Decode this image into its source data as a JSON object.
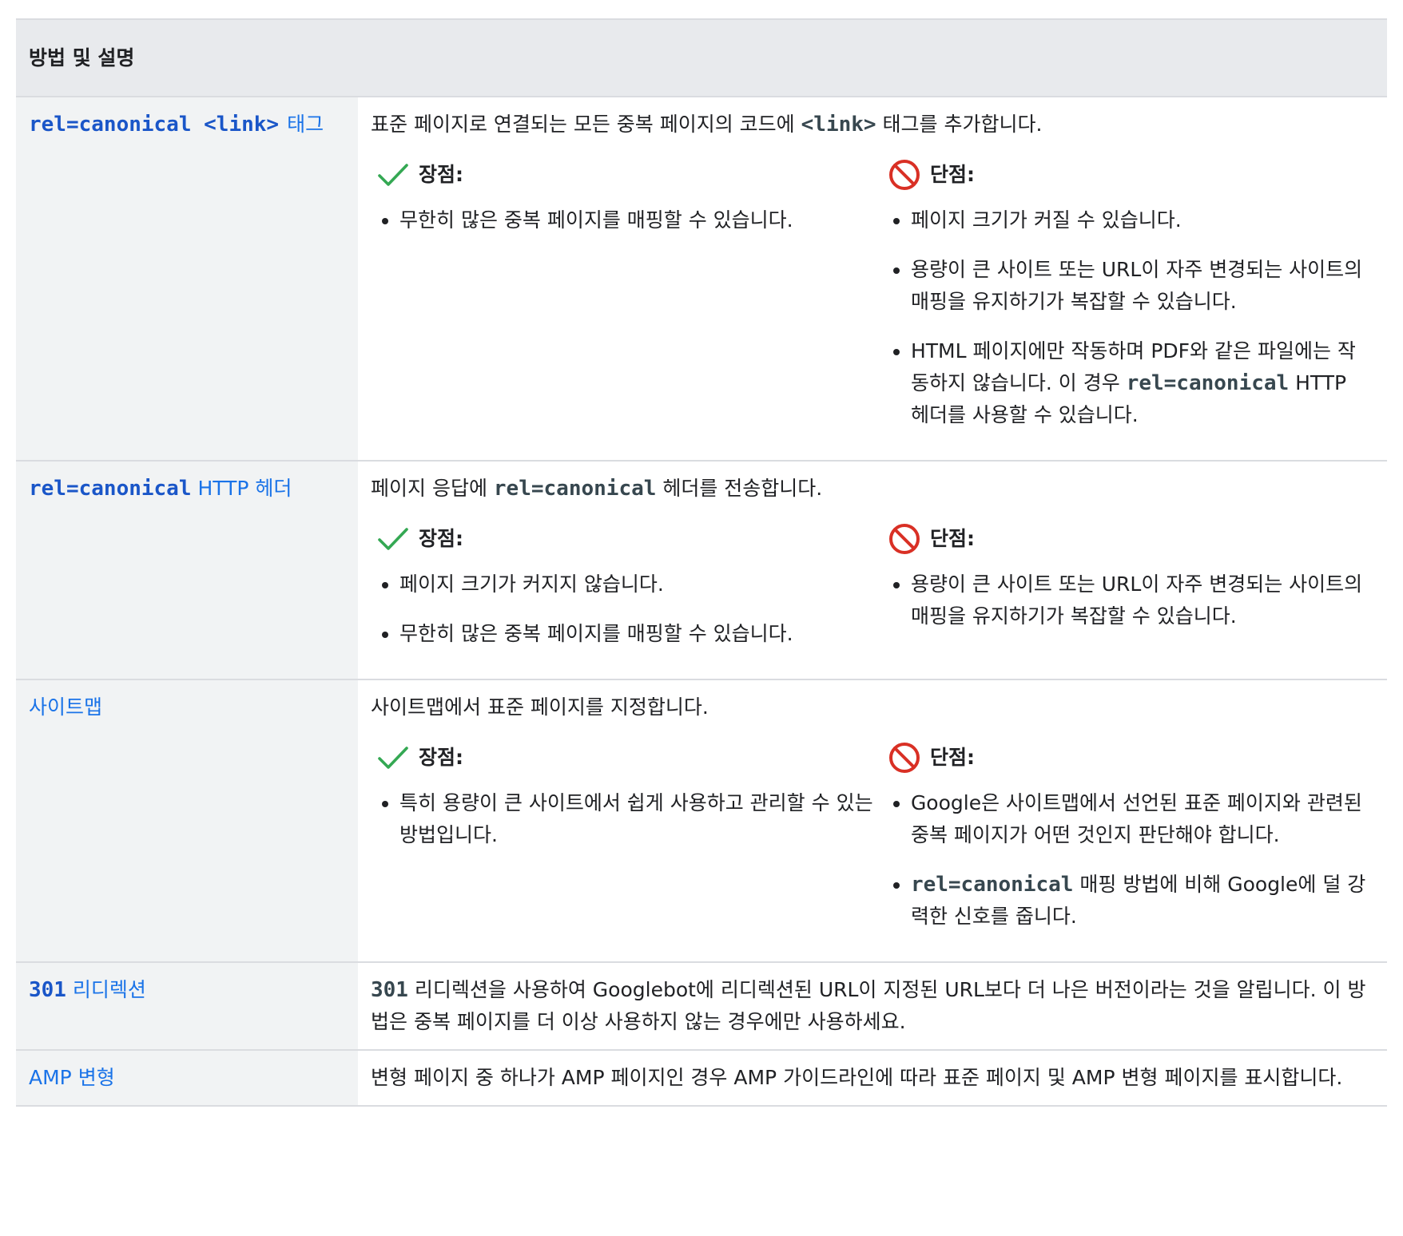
{
  "table": {
    "header": "방법 및 설명",
    "pros_label": "장점:",
    "cons_label": "단점:",
    "rows": [
      {
        "method_code": "rel=canonical <link>",
        "method_text": "태그",
        "summary": [
          {
            "t": "표준 페이지로 연결되는 모든 중복 페이지의 코드에 "
          },
          {
            "c": "<link>"
          },
          {
            "t": " 태그를 추가합니다."
          }
        ],
        "pros": [
          [
            {
              "t": "무한히 많은 중복 페이지를 매핑할 수 있습니다."
            }
          ]
        ],
        "cons": [
          [
            {
              "t": "페이지 크기가 커질 수 있습니다."
            }
          ],
          [
            {
              "t": "용량이 큰 사이트 또는 URL이 자주 변경되는 사이트의 매핑을 유지하기가 복잡할 수 있습니다."
            }
          ],
          [
            {
              "t": "HTML 페이지에만 작동하며 PDF와 같은 파일에는 작동하지 않습니다. 이 경우 "
            },
            {
              "c": "rel=canonical"
            },
            {
              "t": " HTTP 헤더를 사용할 수 있습니다."
            }
          ]
        ]
      },
      {
        "method_code": "rel=canonical",
        "method_text": " HTTP 헤더",
        "summary": [
          {
            "t": "페이지 응답에 "
          },
          {
            "c": "rel=canonical"
          },
          {
            "t": " 헤더를 전송합니다."
          }
        ],
        "pros": [
          [
            {
              "t": "페이지 크기가 커지지 않습니다."
            }
          ],
          [
            {
              "t": "무한히 많은 중복 페이지를 매핑할 수 있습니다."
            }
          ]
        ],
        "cons": [
          [
            {
              "t": "용량이 큰 사이트 또는 URL이 자주 변경되는 사이트의 매핑을 유지하기가 복잡할 수 있습니다."
            }
          ]
        ]
      },
      {
        "method_code": "",
        "method_text": "사이트맵",
        "summary": [
          {
            "t": "사이트맵에서 표준 페이지를 지정합니다."
          }
        ],
        "pros": [
          [
            {
              "t": "특히 용량이 큰 사이트에서 쉽게 사용하고 관리할 수 있는 방법입니다."
            }
          ]
        ],
        "cons": [
          [
            {
              "t": "Google은 사이트맵에서 선언된 표준 페이지와 관련된 중복 페이지가 어떤 것인지 판단해야 합니다."
            }
          ],
          [
            {
              "c": "rel=canonical"
            },
            {
              "t": " 매핑 방법에 비해 Google에 덜 강력한 신호를 줍니다."
            }
          ]
        ]
      },
      {
        "method_code": "301",
        "method_text": " 리디렉션",
        "summary": [
          {
            "c": "301"
          },
          {
            "t": " 리디렉션을 사용하여 Googlebot에 리디렉션된 URL이 지정된 URL보다 더 나은 버전이라는 것을 알립니다. 이 방법은 중복 페이지를 더 이상 사용하지 않는 경우에만 사용하세요."
          }
        ]
      },
      {
        "method_code": "",
        "method_text": "AMP 변형",
        "summary": [
          {
            "t": "변형 페이지 중 하나가 AMP 페이지인 경우 AMP 가이드라인에 따라 표준 페이지 및 AMP 변형 페이지를 표시합니다."
          }
        ]
      }
    ]
  },
  "icons": {
    "pros": "checkmark-icon",
    "cons": "prohibited-icon"
  },
  "colors": {
    "link": "#1a73e8",
    "check": "#34a853",
    "prohibited": "#d93025",
    "header_bg": "#e8eaed",
    "method_bg": "#f1f3f4"
  }
}
